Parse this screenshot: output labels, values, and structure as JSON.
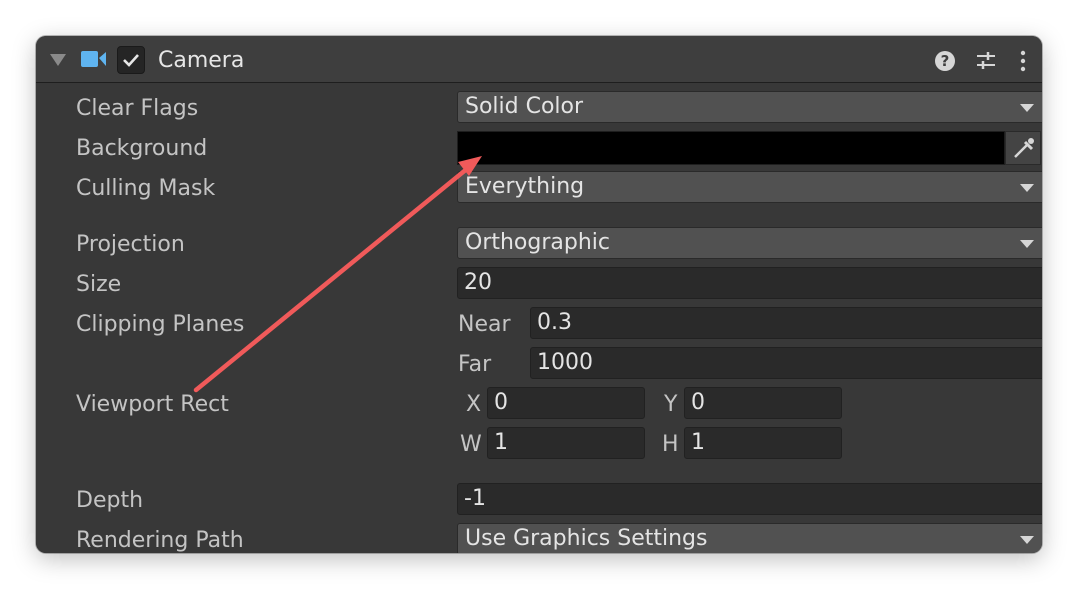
{
  "component": {
    "title": "Camera",
    "enabled": true,
    "icons": [
      "fold-arrow-icon",
      "camera-icon",
      "help-icon",
      "preset-icon",
      "more-icon"
    ]
  },
  "colors": {
    "panel": "#383838",
    "field": "#2a2a2a",
    "dropdown": "#515151",
    "camera_icon": "#5fb4f0",
    "annotation_arrow": "#f05a5a",
    "background_color": "#000000"
  },
  "props": {
    "clear_flags": {
      "label": "Clear Flags",
      "value": "Solid Color"
    },
    "background": {
      "label": "Background"
    },
    "culling_mask": {
      "label": "Culling Mask",
      "value": "Everything"
    },
    "projection": {
      "label": "Projection",
      "value": "Orthographic"
    },
    "size": {
      "label": "Size",
      "value": "20"
    },
    "clipping_planes": {
      "label": "Clipping Planes",
      "near_label": "Near",
      "near_value": "0.3",
      "far_label": "Far",
      "far_value": "1000"
    },
    "viewport_rect": {
      "label": "Viewport Rect",
      "x_label": "X",
      "x_value": "0",
      "y_label": "Y",
      "y_value": "0",
      "w_label": "W",
      "w_value": "1",
      "h_label": "H",
      "h_value": "1"
    },
    "depth": {
      "label": "Depth",
      "value": "-1"
    },
    "rendering_path": {
      "label": "Rendering Path",
      "value": "Use Graphics Settings"
    }
  }
}
